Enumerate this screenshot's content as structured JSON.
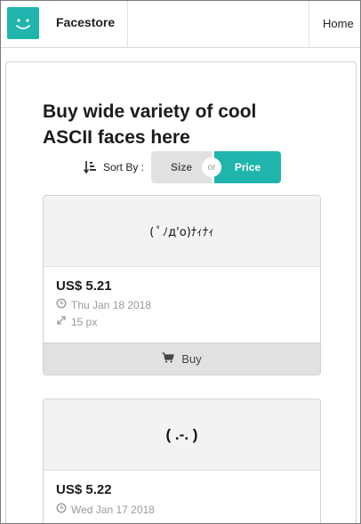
{
  "nav": {
    "brand": "Facestore",
    "home": "Home"
  },
  "hero": {
    "headline": "Buy wide variety of cool ASCII faces here"
  },
  "sort": {
    "label": "Sort By :",
    "options": [
      "Size",
      "Price"
    ],
    "separator": "or",
    "selected": "Price"
  },
  "products": [
    {
      "face": "( ﾟﾉд'o)ﾅｨﾅｨ",
      "price": "US$ 5.21",
      "date": "Thu Jan 18 2018",
      "size": "15 px",
      "buy_label": "Buy"
    },
    {
      "face": "( .-. )",
      "price": "US$ 5.22",
      "date": "Wed Jan 17 2018"
    }
  ],
  "colors": {
    "accent": "#1fb5ac",
    "button_grey": "#e1e1e1",
    "muted_text": "#9a9a9a"
  },
  "icons": {
    "logo": "smiley-icon",
    "sort": "sort-amount-icon",
    "date": "clock-icon",
    "size": "resize-arrows-icon",
    "buy": "shopping-cart-icon"
  }
}
